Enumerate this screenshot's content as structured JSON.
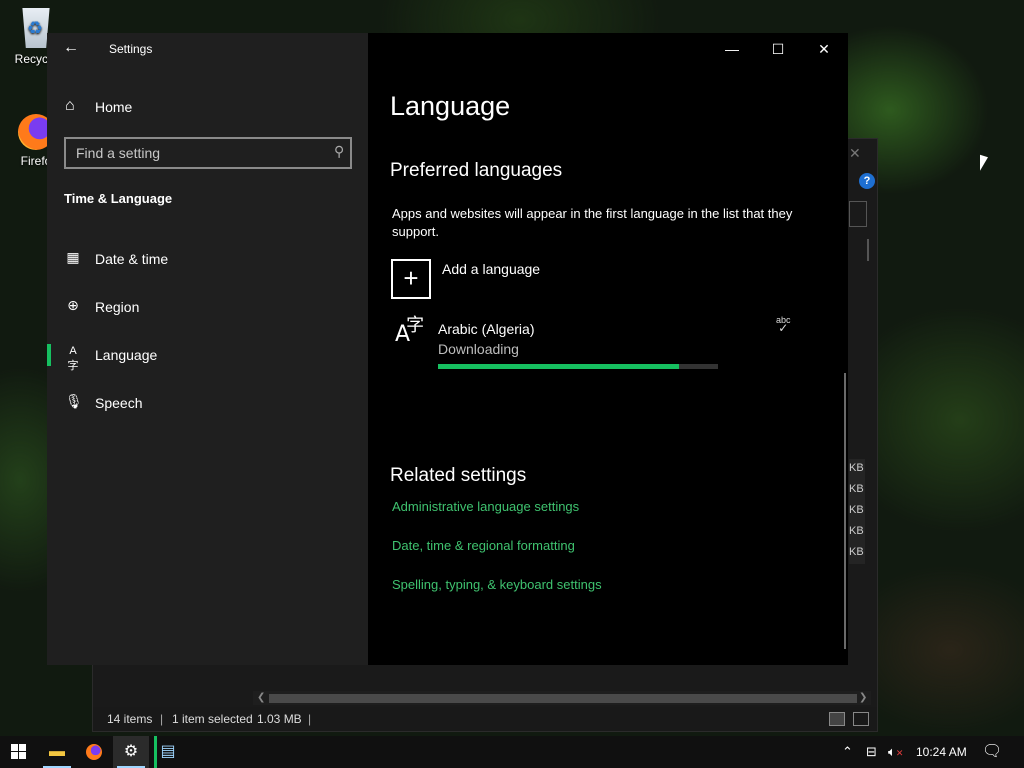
{
  "desktop": {
    "icons": [
      {
        "label": "Recycle",
        "icon": "recycle-bin-icon"
      },
      {
        "label": "Firefo",
        "icon": "firefox-icon"
      }
    ]
  },
  "explorer": {
    "size_units": [
      "KB",
      "KB",
      "KB",
      "KB",
      "KB"
    ],
    "status": {
      "items": "14 items",
      "selected": "1 item selected",
      "size": "1.03 MB"
    }
  },
  "settings": {
    "app_title": "Settings",
    "back_icon": "back-arrow-icon",
    "home_label": "Home",
    "search_placeholder": "Find a setting",
    "section_title": "Time & Language",
    "nav": [
      {
        "label": "Date & time",
        "icon": "calendar-clock-icon",
        "selected": false
      },
      {
        "label": "Region",
        "icon": "globe-icon",
        "selected": false
      },
      {
        "label": "Language",
        "icon": "language-icon",
        "selected": true
      },
      {
        "label": "Speech",
        "icon": "microphone-icon",
        "selected": false
      }
    ],
    "window_controls": {
      "minimize": "—",
      "maximize": "☐",
      "close": "✕"
    },
    "page_title": "Language",
    "preferred_heading": "Preferred languages",
    "preferred_desc": "Apps and websites will appear in the first language in the list that they support.",
    "add_language_label": "Add a language",
    "language_item": {
      "name": "Arabic (Algeria)",
      "status": "Downloading",
      "progress": 0.86
    },
    "related_heading": "Related settings",
    "related_links": [
      "Administrative language settings",
      "Date, time & regional formatting",
      "Spelling, typing, & keyboard settings"
    ],
    "accent_color": "#16c060",
    "link_color": "#3fc26f"
  },
  "taskbar": {
    "clock": "10:24 AM",
    "apps": [
      "start-icon",
      "file-explorer-icon",
      "firefox-icon",
      "settings-gear-icon",
      "notepad-icon"
    ]
  }
}
